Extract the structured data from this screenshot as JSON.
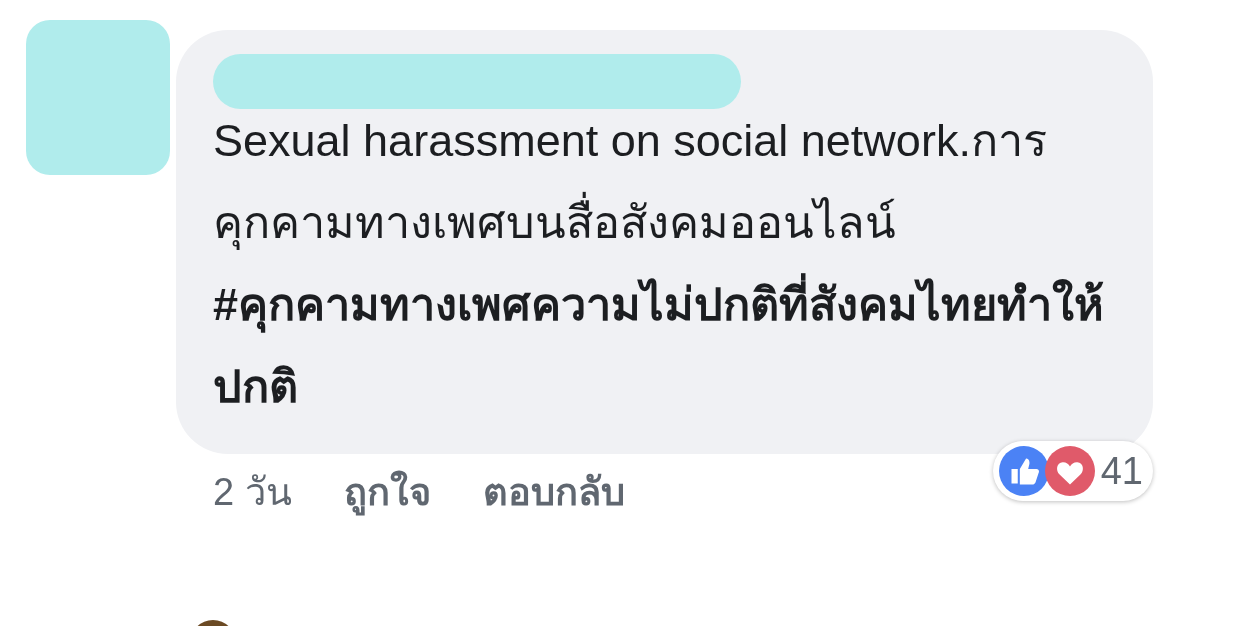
{
  "comment": {
    "text": "Sexual harassment on social network.การคุกคามทางเพศบนสื่อสังคมออนไลน์",
    "hashtag": "#คุกคามทางเพศความไม่ปกติที่สังคมไทยทำให้ปกติ"
  },
  "actions": [
    {
      "label": "2 วัน",
      "kind": "time"
    },
    {
      "label": "ถูกใจ",
      "kind": "link"
    },
    {
      "label": "ตอบกลับ",
      "kind": "link"
    }
  ],
  "reactions": {
    "types": [
      {
        "kind": "like"
      },
      {
        "kind": "love"
      }
    ],
    "count": "41"
  }
}
